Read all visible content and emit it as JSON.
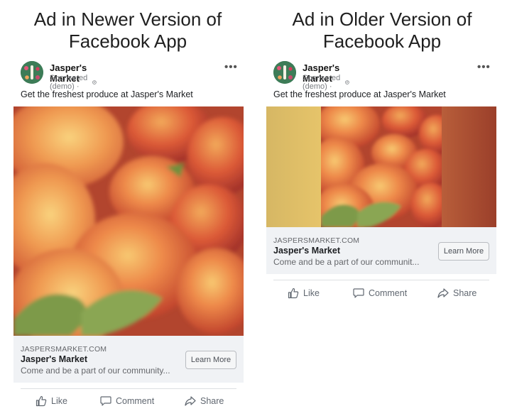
{
  "left": {
    "title": "Ad in Newer Version of Facebook App",
    "page_name": "Jasper's Market",
    "sponsored": "Sponsored (demo) ·",
    "primary_text": "Get the freshest produce at Jasper's Market",
    "domain": "JASPERSMARKET.COM",
    "headline": "Jasper's Market",
    "description": "Come and be a part of our community...",
    "cta": "Learn More",
    "actions": {
      "like": "Like",
      "comment": "Comment",
      "share": "Share"
    }
  },
  "right": {
    "title": "Ad in Older Version of Facebook App",
    "page_name": "Jasper's Market",
    "sponsored": "Sponsored (demo) ·",
    "primary_text": "Get the freshest produce at Jasper's Market",
    "domain": "JASPERSMARKET.COM",
    "headline": "Jasper's Market",
    "description": "Come and be a part of our communit...",
    "cta": "Learn More",
    "actions": {
      "like": "Like",
      "comment": "Comment",
      "share": "Share"
    }
  },
  "icons": {
    "more": "more-dots-icon",
    "globe": "globe-icon",
    "like": "thumbs-up-icon",
    "comment": "comment-bubble-icon",
    "share": "share-arrow-icon"
  },
  "colors": {
    "cta_background": "#f0f2f5",
    "action_text": "#606770",
    "peach": "#e8603a",
    "left_side_bar": "#d9bd64",
    "right_side_bar": "#a04a2e"
  }
}
